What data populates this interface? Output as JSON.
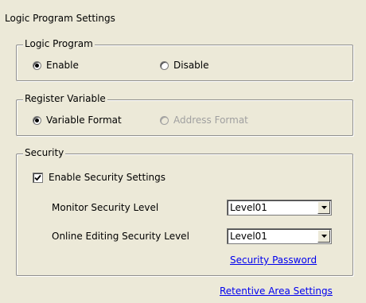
{
  "dialog": {
    "title": "Logic Program Settings"
  },
  "logic_program": {
    "legend": "Logic Program",
    "enable_label": "Enable",
    "disable_label": "Disable",
    "selected": "Enable"
  },
  "register_variable": {
    "legend": "Register Variable",
    "variable_format_label": "Variable Format",
    "address_format_label": "Address Format",
    "selected": "Variable Format",
    "address_format_enabled": false
  },
  "security": {
    "legend": "Security",
    "enable_label": "Enable Security Settings",
    "enable_checked": true,
    "monitor_label": "Monitor Security Level",
    "monitor_value": "Level01",
    "online_editing_label": "Online Editing Security Level",
    "online_editing_value": "Level01",
    "password_link": "Security Password"
  },
  "retentive_area_link": "Retentive Area Settings",
  "icons": {
    "radio_selected": "radio-selected-icon",
    "radio_unselected": "radio-unselected-icon",
    "checkbox_checked": "checkmark-icon",
    "dropdown": "dropdown-arrow-icon"
  }
}
